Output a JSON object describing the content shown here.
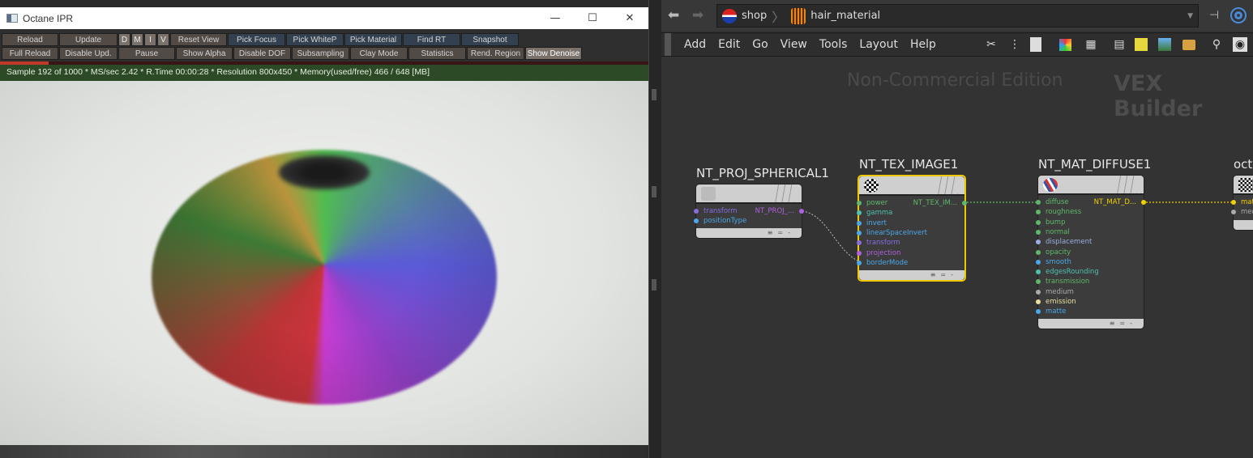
{
  "ipr": {
    "title": "Octane IPR",
    "window_controls": {
      "minimize": "—",
      "maximize": "☐",
      "close": "✕"
    },
    "toolbar_row1": [
      "Reload",
      "Update",
      "D",
      "M",
      "I",
      "V",
      "Reset View",
      "Pick Focus",
      "Pick WhiteP",
      "Pick Material",
      "Find RT",
      "Snapshot"
    ],
    "toolbar_row2": [
      "Full Reload",
      "Disable Upd.",
      "Pause",
      "Show Alpha",
      "Disable DOF",
      "Subsampling",
      "Clay Mode",
      "Statistics",
      "Rend. Region",
      "Show Denoise"
    ],
    "active_button": "Show Denoise",
    "progress": 0.192,
    "status": "Sample 192 of 1000 * MS/sec 2.42 * R.Time 00:00:28 * Resolution 800x450 * Memory(used/free) 466 / 648 [MB]"
  },
  "houdini": {
    "path": [
      "shop",
      "hair_material"
    ],
    "menu": [
      "Add",
      "Edit",
      "Go",
      "View",
      "Tools",
      "Layout",
      "Help"
    ],
    "toolbar_icons": [
      "wrench-icon",
      "tree-icon",
      "list-icon",
      "color-palette-icon",
      "grid-icon",
      "network-box-icon",
      "sticky-note-icon",
      "image-add-icon",
      "package-icon",
      "search-icon",
      "eye-icon"
    ],
    "watermark": "Non-Commercial Edition",
    "context": "VEX Builder",
    "nodes": [
      {
        "name": "NT_PROJ_SPHERICAL1",
        "inputs": [
          {
            "label": "transform",
            "color": "#8a6be0"
          },
          {
            "label": "positionType",
            "color": "#4aa8e8"
          }
        ],
        "output": "NT_PROJ_..."
      },
      {
        "name": "NT_TEX_IMAGE1",
        "selected": true,
        "inputs": [
          {
            "label": "power",
            "color": "#5fb86a"
          },
          {
            "label": "gamma",
            "color": "#4ec0b0"
          },
          {
            "label": "invert",
            "color": "#4aa8e8"
          },
          {
            "label": "linearSpaceInvert",
            "color": "#4aa8e8"
          },
          {
            "label": "transform",
            "color": "#8a6be0"
          },
          {
            "label": "projection",
            "color": "#b060e0"
          },
          {
            "label": "borderMode",
            "color": "#4aa8e8"
          }
        ],
        "output": "NT_TEX_IM..."
      },
      {
        "name": "NT_MAT_DIFFUSE1",
        "inputs": [
          {
            "label": "diffuse",
            "color": "#5fb86a"
          },
          {
            "label": "roughness",
            "color": "#5fb86a"
          },
          {
            "label": "bump",
            "color": "#5fb86a"
          },
          {
            "label": "normal",
            "color": "#5fb86a"
          },
          {
            "label": "displacement",
            "color": "#9aaee0"
          },
          {
            "label": "opacity",
            "color": "#5fb86a"
          },
          {
            "label": "smooth",
            "color": "#4aa8e8"
          },
          {
            "label": "edgesRounding",
            "color": "#4ec0b0"
          },
          {
            "label": "transmission",
            "color": "#5fb86a"
          },
          {
            "label": "medium",
            "color": "#aaaaaa"
          },
          {
            "label": "emission",
            "color": "#e8e0a0"
          },
          {
            "label": "matte",
            "color": "#4aa8e8"
          }
        ],
        "output": "NT_MAT_D..."
      },
      {
        "name": "oct",
        "inputs": [
          {
            "label": "mat",
            "color": "#f0d000"
          },
          {
            "label": "med",
            "color": "#aaaaaa"
          }
        ]
      }
    ]
  }
}
